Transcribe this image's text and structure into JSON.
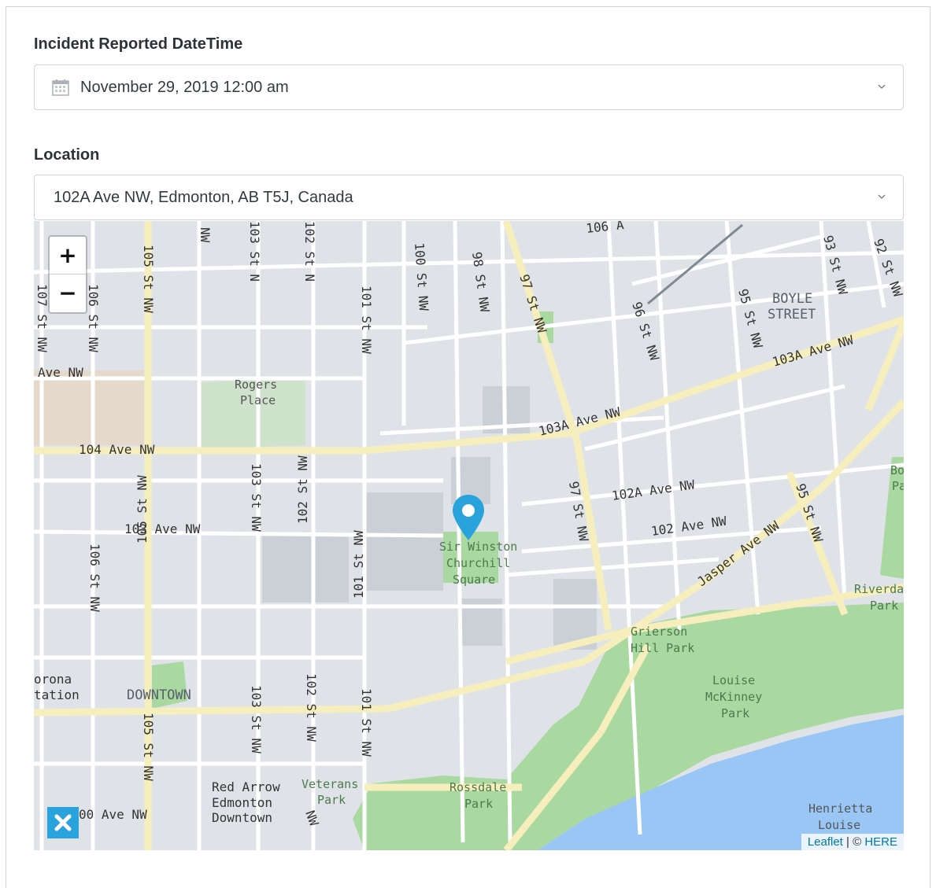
{
  "incident": {
    "label": "Incident Reported DateTime",
    "value": "November 29, 2019 12:00 am",
    "icon": "calendar-icon"
  },
  "location": {
    "label": "Location",
    "value": "102A Ave NW, Edmonton, AB T5J, Canada"
  },
  "map": {
    "zoom_in": "+",
    "zoom_out": "−",
    "attribution_leaflet": "Leaflet",
    "attribution_sep": " | © ",
    "attribution_here": "HERE",
    "streets": {
      "s106a": "106 A",
      "s107": "107 St NW",
      "s106": "106 St NW",
      "s105": "105 St NW",
      "nw": "NW",
      "s103": "103 St N",
      "s102": "102 St N",
      "s101": "101 St NW",
      "s100": "100 St NW",
      "s98": "98 St NW",
      "s97": "97 St NW",
      "s96": "96 St NW",
      "s95": "95 St NW",
      "s93": "93 St NW",
      "s92": "92 St NW",
      "ave_nw": "Ave NW",
      "ave103a": "103A Ave NW",
      "ave103a_b": "103A Ave NW",
      "ave104": "104 Ave NW",
      "ave103": "103 Ave NW",
      "ave102a": "102A Ave NW",
      "ave102": "102 Ave NW",
      "jasper": "Jasper Ave NW",
      "s95b": "95 St NW",
      "s97b": "97 St NW",
      "s106b": "106 St NW",
      "s105b": "105 St NW",
      "s103b": "103 St NW",
      "s102b": "102 St NW",
      "s101b": "101 St NW",
      "s103c": "103 St NW",
      "s102c": "102 St NW",
      "s101c": "101 St NW",
      "s105c": "105 St NW",
      "ave100": "00 Ave NW",
      "nw2": "NW"
    },
    "places": {
      "boyle1": "BOYLE",
      "boyle2": "STREET",
      "rogers1": "Rogers",
      "rogers2": "Place",
      "churchill1": "Sir Winston",
      "churchill2": "Churchill",
      "churchill3": "Square",
      "downtown": "DOWNTOWN",
      "corona1": "orona",
      "corona2": "tation",
      "redarrow1": "Red Arrow",
      "redarrow2": "Edmonton",
      "redarrow3": "Downtown",
      "veterans1": "Veterans",
      "veterans2": "Park",
      "rossdale1": "Rossdale",
      "rossdale2": "Park",
      "grierson1": "Grierson",
      "grierson2": "Hill Park",
      "louise1": "Louise",
      "louise2": "McKinney",
      "louise3": "Park",
      "henrietta1": "Henrietta",
      "henrietta2": "Louise",
      "riverdale1": "Riverda",
      "riverdale2": "Park",
      "bo1": "Bo",
      "bo2": "Pa"
    }
  }
}
